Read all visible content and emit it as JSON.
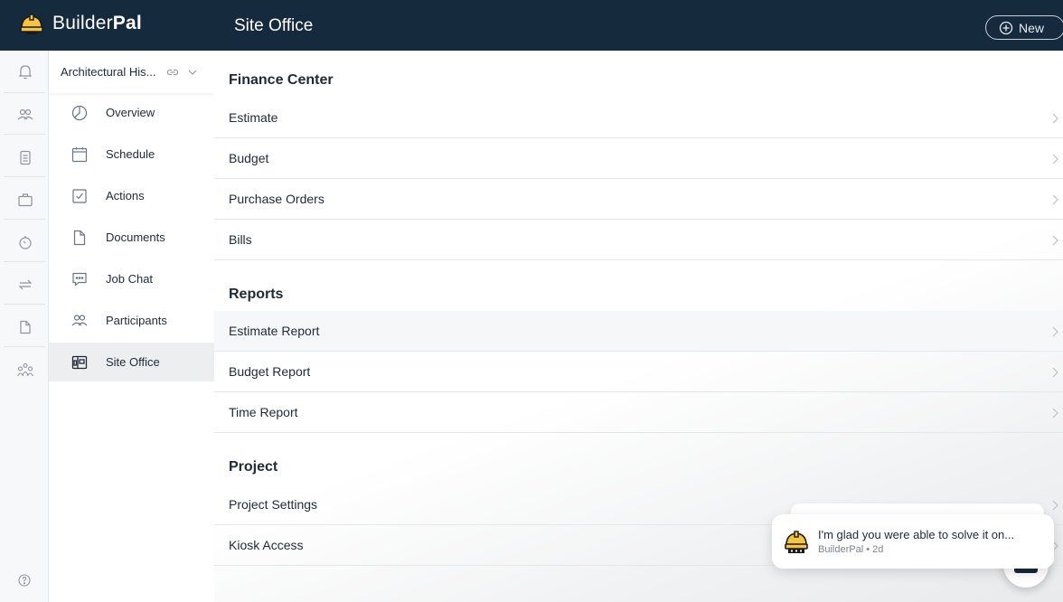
{
  "app": {
    "brand_light": "Builder",
    "brand_bold": "Pal",
    "page_title": "Site Office",
    "new_button_label": "New"
  },
  "rail": {
    "icons": [
      "bell-icon",
      "people-icon",
      "clipboard-icon",
      "briefcase-icon",
      "timer-icon",
      "transfer-icon",
      "document-icon",
      "team-icon"
    ],
    "help_icon": "help-circle-icon"
  },
  "sidebar": {
    "project_name": "Architectural His...",
    "items": [
      {
        "label": "Overview",
        "icon": "pie-chart-icon"
      },
      {
        "label": "Schedule",
        "icon": "calendar-icon"
      },
      {
        "label": "Actions",
        "icon": "checkbox-icon"
      },
      {
        "label": "Documents",
        "icon": "document-icon"
      },
      {
        "label": "Job Chat",
        "icon": "chat-icon"
      },
      {
        "label": "Participants",
        "icon": "people-icon"
      },
      {
        "label": "Site Office",
        "icon": "site-office-icon",
        "active": true
      }
    ]
  },
  "main": {
    "sections": [
      {
        "title": "Finance Center",
        "rows": [
          "Estimate",
          "Budget",
          "Purchase Orders",
          "Bills"
        ]
      },
      {
        "title": "Reports",
        "rows": [
          "Estimate Report",
          "Budget Report",
          "Time Report"
        ]
      },
      {
        "title": "Project",
        "rows": [
          "Project Settings",
          "Kiosk Access"
        ]
      }
    ]
  },
  "toast": {
    "message": "I'm glad you were able to solve it on...",
    "meta": "BuilderPal • 2d"
  },
  "colors": {
    "topbar": "#152a3d",
    "hardhat": "#f6c445",
    "active_nav": "#eceef0"
  }
}
